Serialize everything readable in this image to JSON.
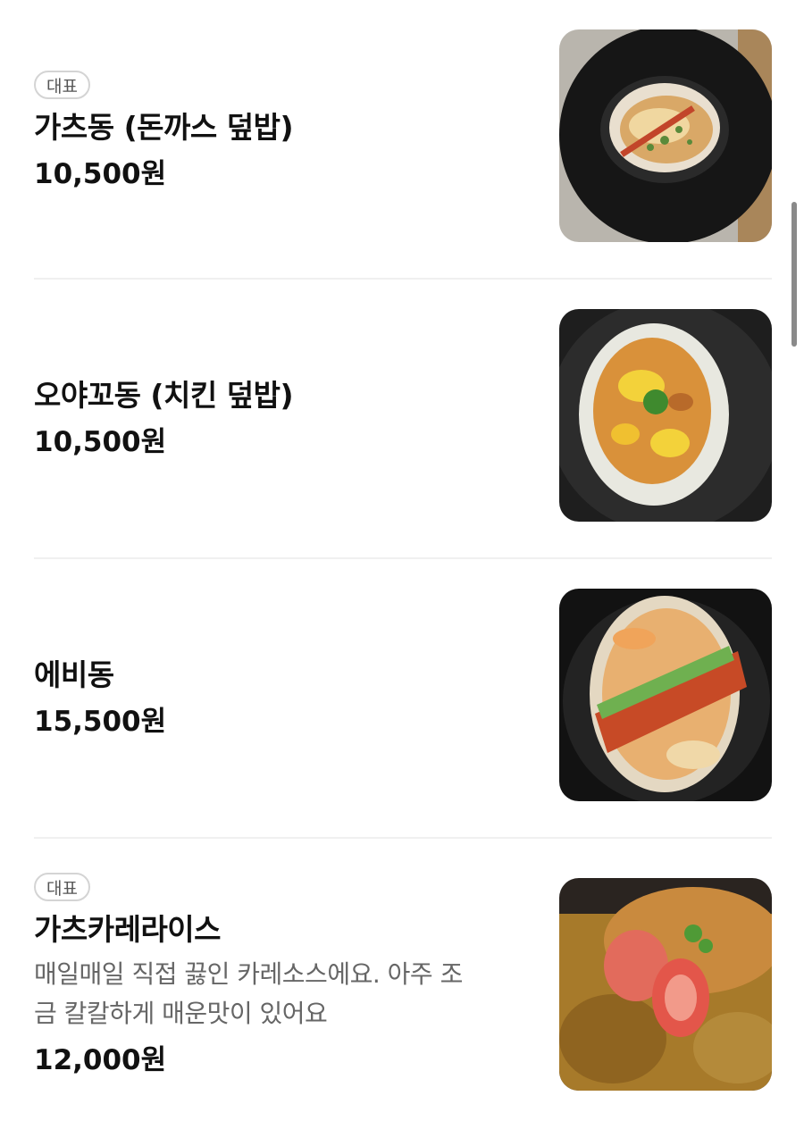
{
  "menu": {
    "items": [
      {
        "badge": "대표",
        "name": "가츠동 (돈까스 덮밥)",
        "price": "10,500원",
        "image": "katsudon-photo"
      },
      {
        "name": "오야꼬동 (치킨 덮밥)",
        "price": "10,500원",
        "image": "oyakodon-photo"
      },
      {
        "name": "에비동",
        "price": "15,500원",
        "image": "ebidon-photo"
      },
      {
        "badge": "대표",
        "name": "가츠카레라이스",
        "description_line1": "매일매일 직접 끓인 카레소스에요. 아주 조",
        "description_line2": "금 칼칼하게 매운맛이 있어요",
        "price": "12,000원",
        "image": "katsu-curry-rice-photo"
      }
    ]
  }
}
